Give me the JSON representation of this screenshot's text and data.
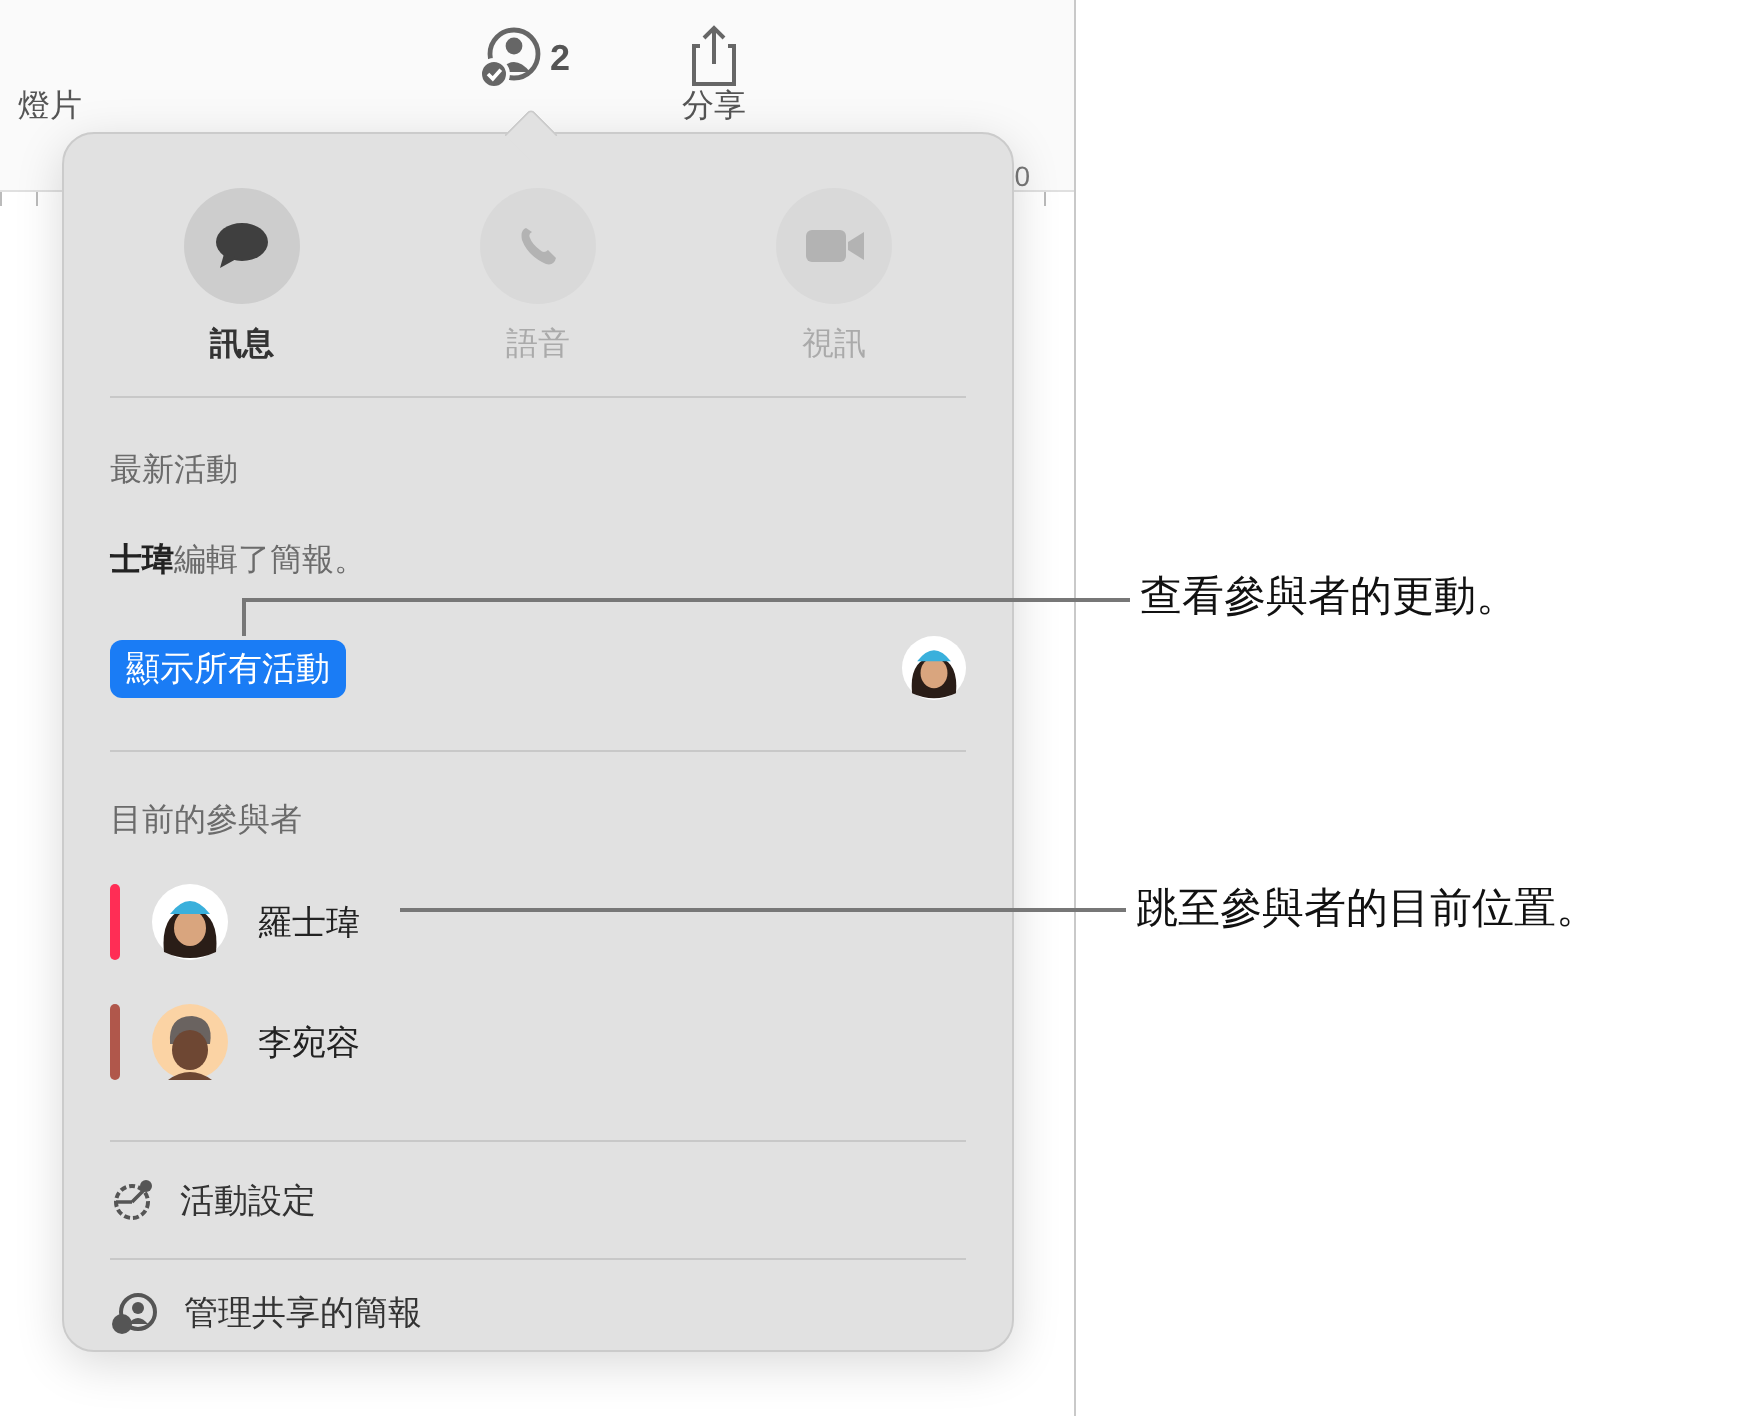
{
  "toolbar": {
    "left_label": "燈片",
    "collaborate_count": "2",
    "share_label": "分享"
  },
  "ruler": {
    "mark": "0"
  },
  "popover": {
    "actions": [
      {
        "label": "訊息",
        "kind": "message",
        "disabled": false
      },
      {
        "label": "語音",
        "kind": "voice",
        "disabled": true
      },
      {
        "label": "視訊",
        "kind": "video",
        "disabled": true
      }
    ],
    "recent_activity": {
      "heading": "最新活動",
      "message": "**士瑋**編輯了簡報。",
      "button": "顯示所有活動"
    },
    "participants": {
      "heading": "目前的參與者",
      "items": [
        {
          "name": "羅士瑋",
          "color": "#ff2d55",
          "kind": "blue-cap"
        },
        {
          "name": "李宛容",
          "color": "#b0574b",
          "kind": "grey-hair"
        }
      ]
    },
    "menu": [
      {
        "label": "活動設定",
        "kind": "settings"
      },
      {
        "label": "管理共享的簡報",
        "kind": "manage"
      }
    ]
  },
  "callouts": [
    {
      "text": "查看參與者的更動。"
    },
    {
      "text": "跳至參與者的目前位置。"
    }
  ]
}
